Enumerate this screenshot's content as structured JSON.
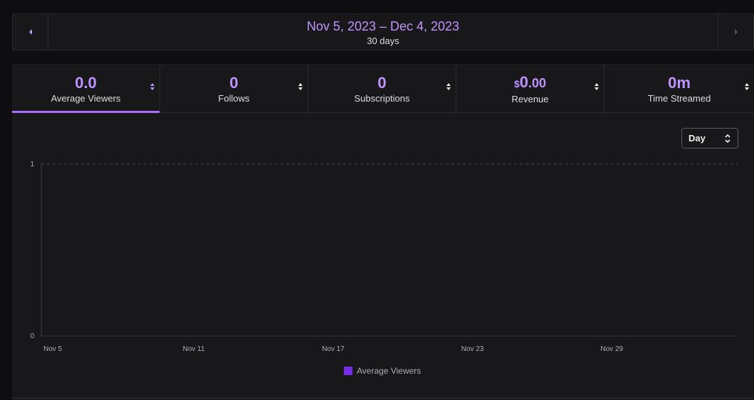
{
  "date_range": {
    "range": "Nov 5, 2023 – Dec 4, 2023",
    "duration": "30 days"
  },
  "tabs": [
    {
      "value": "0.0",
      "label": "Average Viewers",
      "active": true
    },
    {
      "value": "0",
      "label": "Follows",
      "active": false
    },
    {
      "value": "0",
      "label": "Subscriptions",
      "active": false
    },
    {
      "value_currency": "$",
      "value_int": "0",
      "value_dec": ".00",
      "label": "Revenue",
      "active": false
    },
    {
      "value": "0m",
      "label": "Time Streamed",
      "active": false
    }
  ],
  "interval_select": {
    "value": "Day"
  },
  "icons": {
    "prev": "chevron-left-icon",
    "next": "chevron-right-icon",
    "sort": "sort-icon",
    "select": "up-down-caret-icon"
  },
  "colors": {
    "accent": "#bf94ff",
    "series": "#772ce8",
    "active_underline": "#a970ff"
  },
  "chart_data": {
    "type": "line",
    "x_tick_labels": [
      "Nov 5",
      "Nov 11",
      "Nov 17",
      "Nov 23",
      "Nov 29"
    ],
    "y_tick_labels": [
      "0",
      "1"
    ],
    "ylim": [
      0,
      1
    ],
    "series": [
      {
        "name": "Average Viewers",
        "color": "#772ce8",
        "values": [
          0,
          0,
          0,
          0,
          0,
          0,
          0,
          0,
          0,
          0,
          0,
          0,
          0,
          0,
          0,
          0,
          0,
          0,
          0,
          0,
          0,
          0,
          0,
          0,
          0,
          0,
          0,
          0,
          0,
          0
        ]
      }
    ],
    "grid": true,
    "legend": "bottom-center"
  }
}
